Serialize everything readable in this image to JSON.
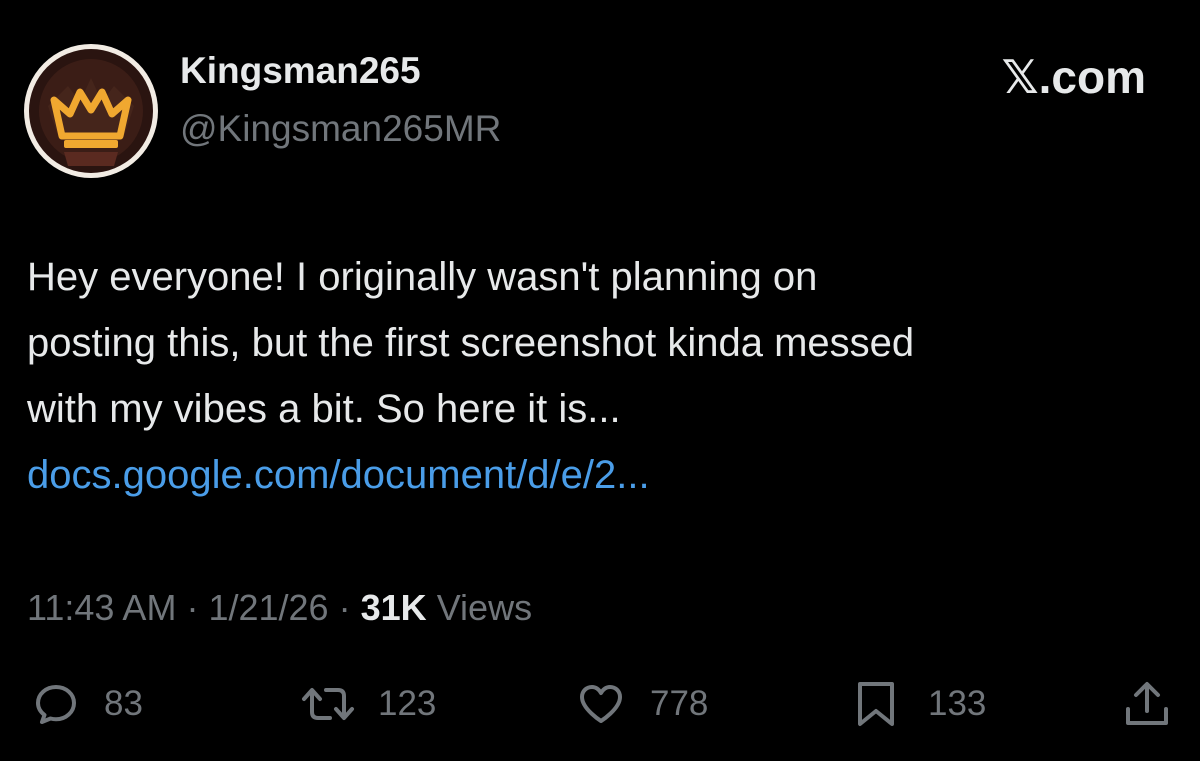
{
  "author": {
    "display_name": "Kingsman265",
    "handle": "@Kingsman265MR",
    "avatar_icon": "crown-icon"
  },
  "brand": "𝕏.com",
  "body": {
    "lines": [
      "Hey everyone! I originally wasn't planning on",
      "posting this, but the first screenshot kinda messed",
      "with my vibes a bit. So here it is..."
    ],
    "link_text": "docs.google.com/document/d/e/2..."
  },
  "meta": {
    "time": "11:43 AM",
    "separator": "·",
    "date": "1/21/26",
    "views_count": "31K",
    "views_label": "Views"
  },
  "actions": {
    "replies": {
      "icon": "reply-icon",
      "count": "83"
    },
    "reposts": {
      "icon": "repost-icon",
      "count": "123"
    },
    "likes": {
      "icon": "heart-icon",
      "count": "778"
    },
    "bookmarks": {
      "icon": "bookmark-icon",
      "count": "133"
    },
    "share": {
      "icon": "share-icon"
    }
  },
  "colors": {
    "background": "#000000",
    "primary_text": "#e7e9ea",
    "secondary_text": "#71767b",
    "link": "#4a9de8",
    "avatar_crown": "#f0a830"
  }
}
